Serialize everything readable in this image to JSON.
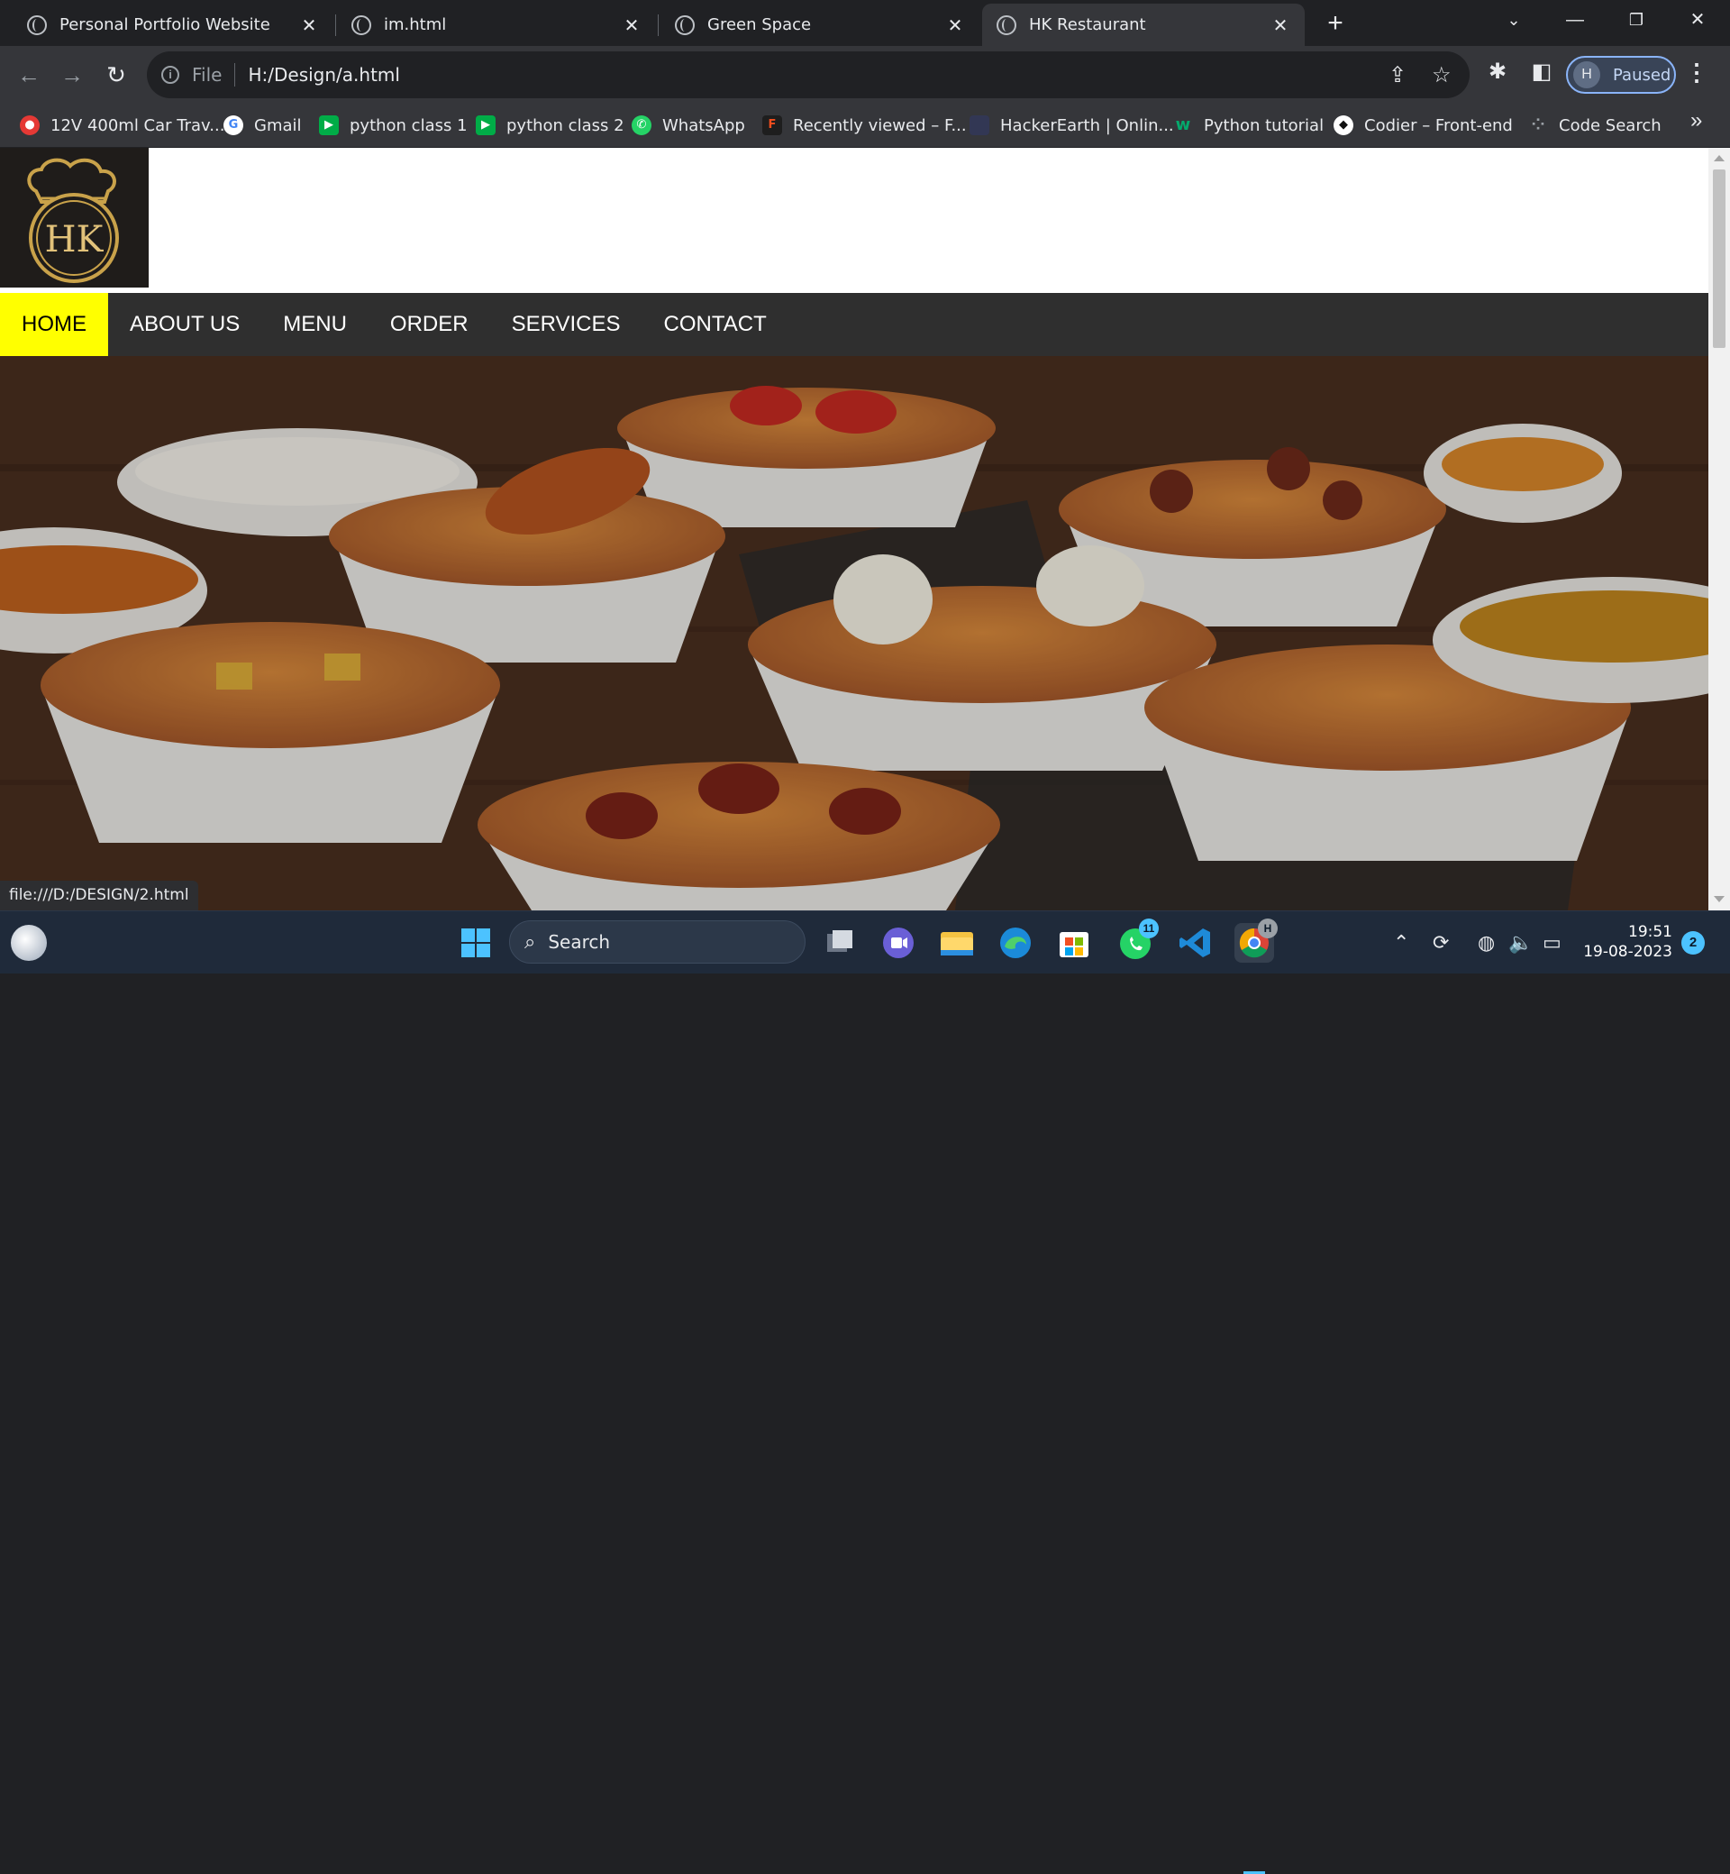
{
  "browser": {
    "tabs": [
      {
        "title": "Personal Portfolio Website",
        "active": false
      },
      {
        "title": "im.html",
        "active": false
      },
      {
        "title": "Green Space",
        "active": false
      },
      {
        "title": "HK Restaurant",
        "active": true
      }
    ],
    "address": {
      "scheme": "File",
      "url": "H:/Design/a.html"
    },
    "profile": {
      "initial": "H",
      "status": "Paused"
    },
    "bookmarks": [
      {
        "label": "12V 400ml Car Trav...",
        "icon": "red-circle-icon",
        "color": "#e53935"
      },
      {
        "label": "Gmail",
        "icon": "google-icon",
        "color": "#ffffff"
      },
      {
        "label": "python class 1",
        "icon": "meet-icon",
        "color": "#00ac47"
      },
      {
        "label": "python class 2",
        "icon": "meet-icon",
        "color": "#00ac47"
      },
      {
        "label": "WhatsApp",
        "icon": "whatsapp-icon",
        "color": "#25d366"
      },
      {
        "label": "Recently viewed – F...",
        "icon": "figma-icon",
        "color": "#f24e1e"
      },
      {
        "label": "HackerEarth | Onlin...",
        "icon": "hackerearth-icon",
        "color": "#323754"
      },
      {
        "label": "Python tutorial",
        "icon": "w3schools-icon",
        "color": "#04aa6d"
      },
      {
        "label": "Codier – Front-end",
        "icon": "codier-icon",
        "color": "#111111"
      },
      {
        "label": "Code Search",
        "icon": "code-search-icon",
        "color": "#9aa0a6"
      }
    ],
    "status_url": "file:///D:/DESIGN/2.html"
  },
  "site": {
    "logo_text": "HK",
    "nav": [
      {
        "label": "HOME",
        "active": true
      },
      {
        "label": "ABOUT US",
        "active": false
      },
      {
        "label": "MENU",
        "active": false
      },
      {
        "label": "ORDER",
        "active": false
      },
      {
        "label": "SERVICES",
        "active": false
      },
      {
        "label": "CONTACT",
        "active": false
      }
    ],
    "accent": "#ffff00",
    "nav_bg": "#2f2f2f"
  },
  "taskbar": {
    "search_label": "Search",
    "time": "19:51",
    "date": "19-08-2023",
    "notifications": "2",
    "whatsapp_badge": "11",
    "chrome_badge": "H"
  }
}
